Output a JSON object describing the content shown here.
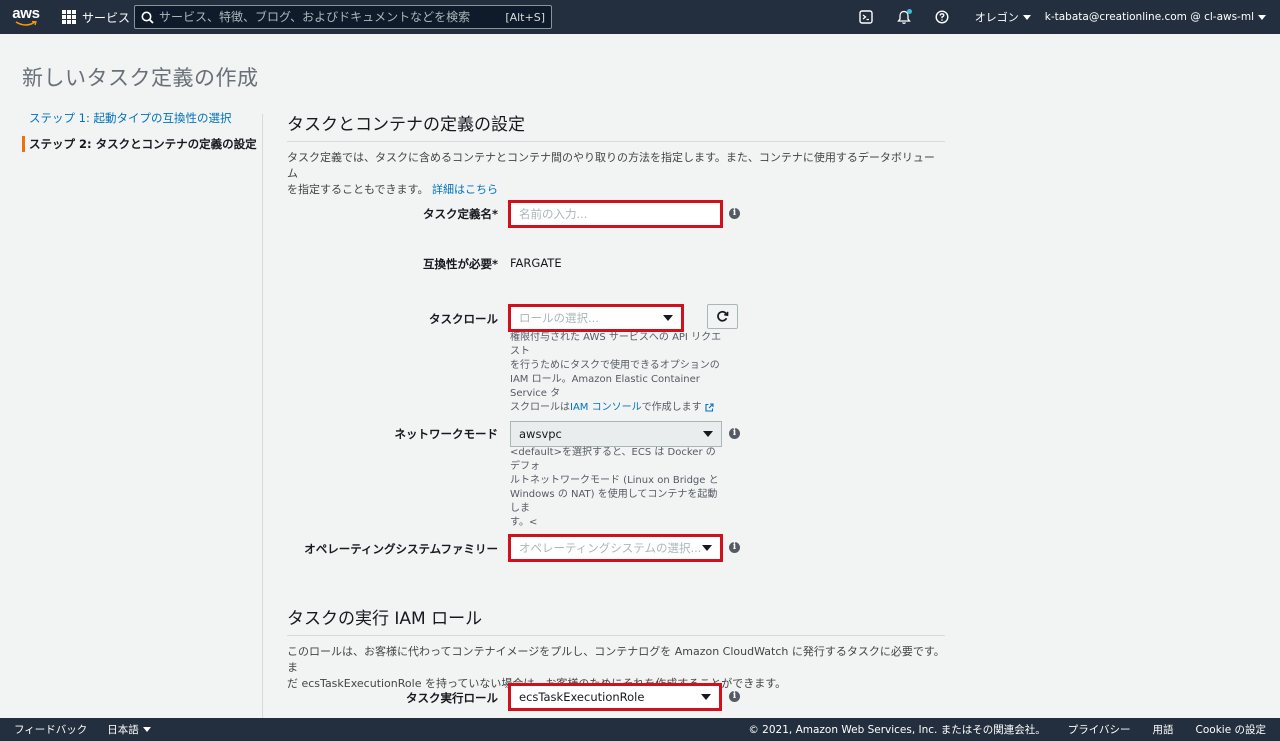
{
  "topnav": {
    "logo_text": "aws",
    "services_label": "サービス",
    "search_placeholder": "サービス、特徴、ブログ、およびドキュメントなどを検索",
    "search_shortcut": "[Alt+S]",
    "region": "オレゴン",
    "account": "k-tabata@creationline.com @ cl-aws-ml"
  },
  "page": {
    "title": "新しいタスク定義の作成"
  },
  "steps": [
    {
      "label": "ステップ 1: 起動タイプの互換性の選択",
      "active": false
    },
    {
      "label": "ステップ 2: タスクとコンテナの定義の設定",
      "active": true
    }
  ],
  "section1": {
    "title": "タスクとコンテナの定義の設定",
    "desc_line1": "タスク定義では、タスクに含めるコンテナとコンテナ間のやり取りの方法を指定します。また、コンテナに使用するデータボリューム",
    "desc_line2": "を指定することもできます。",
    "learn_more": "詳細はこちら"
  },
  "fields": {
    "task_def_name": {
      "label": "タスク定義名*",
      "placeholder": "名前の入力..."
    },
    "compat": {
      "label": "互換性が必要*",
      "value": "FARGATE"
    },
    "task_role": {
      "label": "タスクロール",
      "placeholder": "ロールの選択...",
      "help_line1": "権限付与された AWS サービスへの API リクエスト",
      "help_line2": "を行うためにタスクで使用できるオプションの",
      "help_line3": "IAM ロール。Amazon Elastic Container Service タ",
      "help_line4a": "スクロールは",
      "help_link": "IAM コンソール",
      "help_line4b": "で作成します"
    },
    "network_mode": {
      "label": "ネットワークモード",
      "value": "awsvpc",
      "help_line1": "<default>を選択すると、ECS は Docker のデフォ",
      "help_line2": "ルトネットワークモード (Linux on Bridge と",
      "help_line3": "Windows の NAT) を使用してコンテナを起動しま",
      "help_line4": "す。<"
    },
    "os_family": {
      "label": "オペレーティングシステムファミリー",
      "placeholder": "オペレーティングシステムの選択..."
    },
    "exec_role": {
      "label": "タスク実行ロール",
      "value": "ecsTaskExecutionRole"
    }
  },
  "section2": {
    "title": "タスクの実行 IAM ロール",
    "desc_line1": "このロールは、お客様に代わってコンテナイメージをプルし、コンテナログを Amazon CloudWatch に発行するタスクに必要です。ま",
    "desc_line2": "だ ecsTaskExecutionRole を持っていない場合は、お客様のためにそれを作成することができます。"
  },
  "footer": {
    "feedback": "フィードバック",
    "language": "日本語",
    "copyright": "© 2021, Amazon Web Services, Inc. またはその関連会社。",
    "privacy": "プライバシー",
    "terms": "用語",
    "cookie": "Cookie の設定"
  },
  "colors": {
    "nav_bg": "#232f3e",
    "link": "#0073bb",
    "highlight": "#d0101c",
    "active_step": "#ec7211"
  }
}
